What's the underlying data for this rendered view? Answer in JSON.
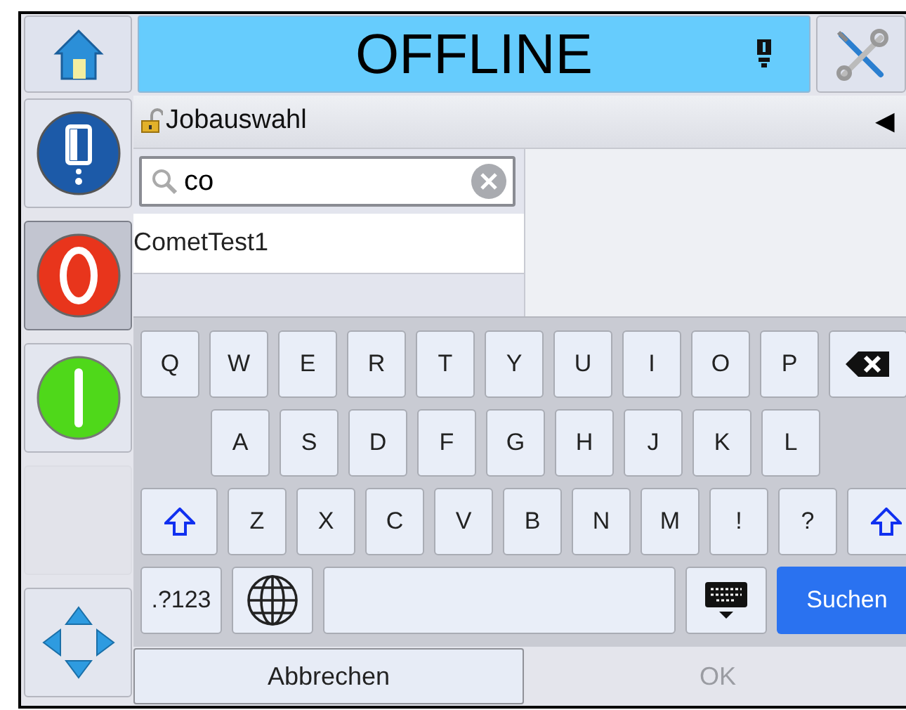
{
  "header": {
    "status": "OFFLINE"
  },
  "breadcrumb": {
    "title": "Jobauswahl",
    "locked": false,
    "collapse": "◀"
  },
  "search": {
    "value": "co"
  },
  "results": [
    {
      "name": "CometTest1",
      "selected": false
    }
  ],
  "side_buttons": [
    {
      "kind": "ink",
      "selected": false
    },
    {
      "kind": "stop",
      "selected": true
    },
    {
      "kind": "start",
      "selected": false
    },
    {
      "kind": "empty",
      "selected": false
    },
    {
      "kind": "navigate",
      "selected": false
    }
  ],
  "keyboard": [
    [
      {
        "kind": "char",
        "label": "Q"
      },
      {
        "kind": "char",
        "label": "W"
      },
      {
        "kind": "char",
        "label": "E"
      },
      {
        "kind": "char",
        "label": "R"
      },
      {
        "kind": "char",
        "label": "T"
      },
      {
        "kind": "char",
        "label": "Y"
      },
      {
        "kind": "char",
        "label": "U"
      },
      {
        "kind": "char",
        "label": "I"
      },
      {
        "kind": "char",
        "label": "O"
      },
      {
        "kind": "char",
        "label": "P"
      },
      {
        "kind": "backspace"
      }
    ],
    [
      {
        "kind": "char",
        "label": "A"
      },
      {
        "kind": "char",
        "label": "S"
      },
      {
        "kind": "char",
        "label": "D"
      },
      {
        "kind": "char",
        "label": "F"
      },
      {
        "kind": "char",
        "label": "G"
      },
      {
        "kind": "char",
        "label": "H"
      },
      {
        "kind": "char",
        "label": "J"
      },
      {
        "kind": "char",
        "label": "K"
      },
      {
        "kind": "char",
        "label": "L"
      }
    ],
    [
      {
        "kind": "shift"
      },
      {
        "kind": "char",
        "label": "Z"
      },
      {
        "kind": "char",
        "label": "X"
      },
      {
        "kind": "char",
        "label": "C"
      },
      {
        "kind": "char",
        "label": "V"
      },
      {
        "kind": "char",
        "label": "B"
      },
      {
        "kind": "char",
        "label": "N"
      },
      {
        "kind": "char",
        "label": "M"
      },
      {
        "kind": "char",
        "label": "!"
      },
      {
        "kind": "char",
        "label": "?"
      },
      {
        "kind": "shift"
      }
    ],
    [
      {
        "kind": "symbols",
        "label": ".?123"
      },
      {
        "kind": "globe"
      },
      {
        "kind": "space"
      },
      {
        "kind": "hide"
      },
      {
        "kind": "action",
        "label": "Suchen"
      }
    ]
  ],
  "footer": [
    {
      "label": "Abbrechen",
      "disabled": false
    },
    {
      "label": "OK",
      "disabled": true
    }
  ]
}
